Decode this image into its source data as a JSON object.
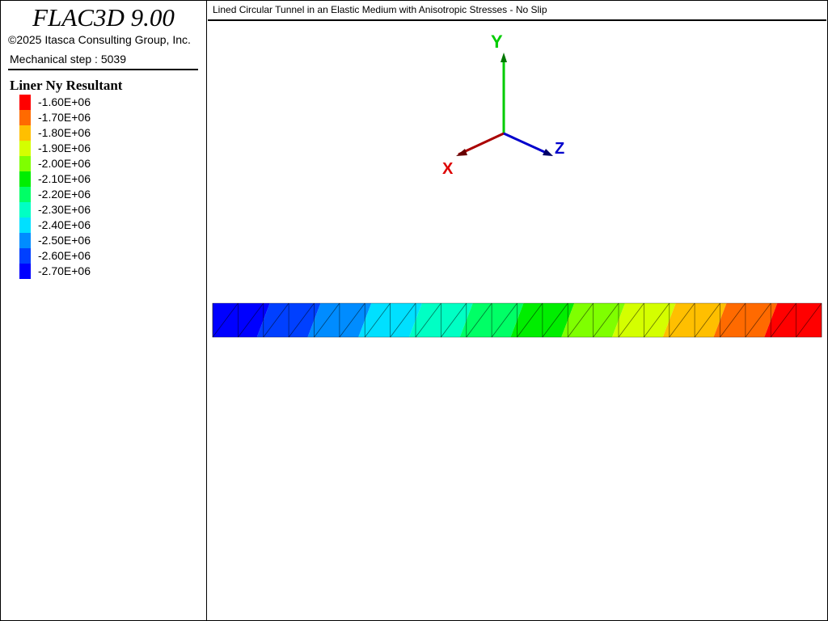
{
  "app": {
    "title": "FLAC3D 9.00",
    "copyright": "©2025 Itasca Consulting Group, Inc.",
    "step": "Mechanical step : 5039"
  },
  "legend": {
    "title": "Liner Ny Resultant",
    "items": [
      {
        "label": "-1.60E+06",
        "value": -1600000,
        "color": "#ff0000"
      },
      {
        "label": "-1.70E+06",
        "value": -1700000,
        "color": "#ff6a00"
      },
      {
        "label": "-1.80E+06",
        "value": -1800000,
        "color": "#ffbf00"
      },
      {
        "label": "-1.90E+06",
        "value": -1900000,
        "color": "#d4ff00"
      },
      {
        "label": "-2.00E+06",
        "value": -2000000,
        "color": "#7fff00"
      },
      {
        "label": "-2.10E+06",
        "value": -2100000,
        "color": "#00ee00"
      },
      {
        "label": "-2.20E+06",
        "value": -2200000,
        "color": "#00ff66"
      },
      {
        "label": "-2.30E+06",
        "value": -2300000,
        "color": "#00ffc4"
      },
      {
        "label": "-2.40E+06",
        "value": -2400000,
        "color": "#00e0ff"
      },
      {
        "label": "-2.50E+06",
        "value": -2500000,
        "color": "#008cff"
      },
      {
        "label": "-2.60E+06",
        "value": -2600000,
        "color": "#0040ff"
      },
      {
        "label": "-2.70E+06",
        "value": -2700000,
        "color": "#0000ff"
      }
    ]
  },
  "plot": {
    "title": "Lined Circular Tunnel in an Elastic Medium with Anisotropic Stresses - No Slip"
  },
  "axes": {
    "x": {
      "label": "X",
      "color": "#cc0000"
    },
    "y": {
      "label": "Y",
      "color": "#00cc00"
    },
    "z": {
      "label": "Z",
      "color": "#0000cc"
    }
  },
  "liner": {
    "bands": [
      "#0000ff",
      "#0040ff",
      "#008cff",
      "#00e0ff",
      "#00ffc4",
      "#00ff66",
      "#00ee00",
      "#7fff00",
      "#d4ff00",
      "#ffbf00",
      "#ff6a00",
      "#ff0000"
    ]
  }
}
